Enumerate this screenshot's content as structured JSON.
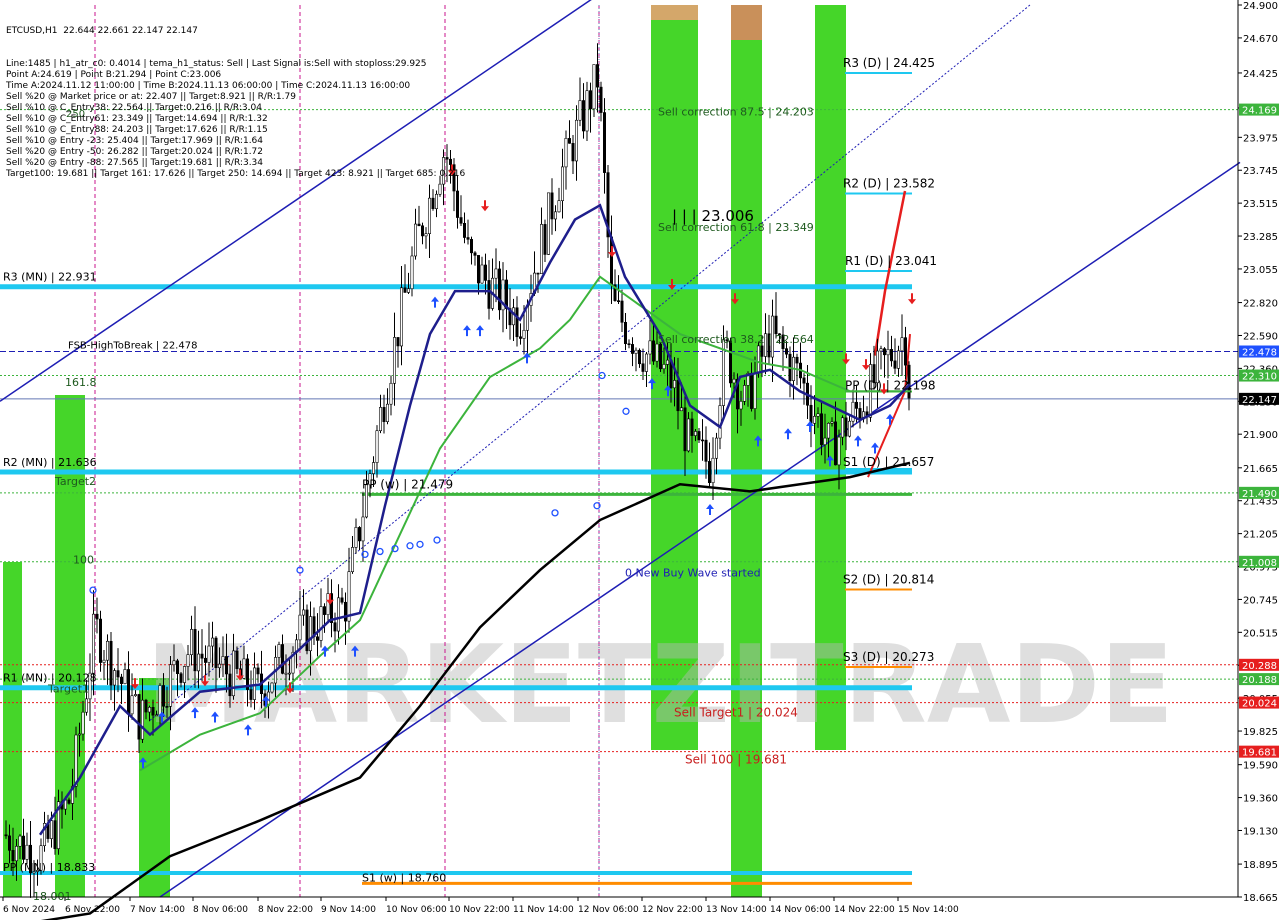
{
  "chart_data": {
    "type": "candlestick",
    "symbol_line": "ETCUSD,H1  22.644 22.661 22.147 22.147",
    "info_lines": [
      "Line:1485 | h1_atr_c0: 0.4014 | tema_h1_status: Sell | Last Signal is:Sell with stoploss:29.925",
      "Point A:24.619 | Point B:21.294 | Point C:23.006",
      "Time A:2024.11.12 11:00:00 | Time B:2024.11.13 06:00:00 | Time C:2024.11.13 16:00:00",
      "Sell %20 @ Market price or at: 22.407 || Target:8.921 || R/R:1.79",
      "Sell %10 @ C_Entry38: 22.564 || Target:0.216 || R/R:3.04",
      "Sell %10 @ C_Entry61: 23.349 || Target:14.694 || R/R:1.32",
      "Sell %10 @ C_Entry88: 24.203 || Target:17.626 || R/R:1.15",
      "Sell %10 @ Entry -23: 25.404 || Target:17.969 || R/R:1.64",
      "Sell %20 @ Entry -50: 26.282 || Target:20.024 || R/R:1.72",
      "Sell %20 @ Entry -88: 27.565 || Target:19.681 || R/R:3.34",
      "Target100: 19.681 || Target 161: 17.626 || Target 250: 14.694 || Target 423: 8.921 || Target 685: 0.216"
    ],
    "y_ticks": [
      "24.900",
      "24.670",
      "24.425",
      "24.180",
      "23.975",
      "23.745",
      "23.515",
      "23.285",
      "23.055",
      "22.820",
      "22.590",
      "22.360",
      "22.130",
      "21.900",
      "21.665",
      "21.435",
      "21.205",
      "20.975",
      "20.745",
      "20.515",
      "20.285",
      "20.055",
      "19.825",
      "19.590",
      "19.360",
      "19.130",
      "18.895",
      "18.665"
    ],
    "y_range": [
      18.665,
      24.9
    ],
    "x_labels": [
      "6 Nov 2024",
      "6 Nov 22:00",
      "7 Nov 14:00",
      "8 Nov 06:00",
      "8 Nov 22:00",
      "9 Nov 14:00",
      "10 Nov 06:00",
      "10 Nov 22:00",
      "11 Nov 14:00",
      "12 Nov 06:00",
      "12 Nov 22:00",
      "13 Nov 14:00",
      "14 Nov 06:00",
      "14 Nov 22:00",
      "15 Nov 14:00"
    ],
    "price_badges": [
      {
        "value": "24.169",
        "color": "#3cb43c"
      },
      {
        "value": "22.478",
        "color": "#1e50ff"
      },
      {
        "value": "22.310",
        "color": "#3cb43c"
      },
      {
        "value": "22.147",
        "color": "#000000"
      },
      {
        "value": "21.490",
        "color": "#3cb43c"
      },
      {
        "value": "21.008",
        "color": "#3cb43c"
      },
      {
        "value": "20.288",
        "color": "#e61e1e"
      },
      {
        "value": "20.188",
        "color": "#3cb43c"
      },
      {
        "value": "20.024",
        "color": "#e61e1e"
      },
      {
        "value": "19.681",
        "color": "#e61e1e"
      }
    ],
    "levels": [
      {
        "label": "R3 (MN) | 22.931",
        "value": 22.931,
        "color": "#1ec8f0"
      },
      {
        "label": "R2 (MN) | 21.636",
        "value": 21.636,
        "color": "#1ec8f0"
      },
      {
        "label": "R1 (MN) | 20.128",
        "value": 20.128,
        "color": "#1ec8f0"
      },
      {
        "label": "PP (MN) | 18.833",
        "value": 18.833,
        "color": "#1ec8f0"
      },
      {
        "label": "S1 (w) | 18.760",
        "value": 18.76,
        "color": "#ff8c00"
      },
      {
        "label": "FSB-HighToBreak | 22.478",
        "value": 22.478,
        "color": "#1e1eb4"
      },
      {
        "label": "R3 (D) | 24.425",
        "value": 24.425,
        "color": "#1ec8f0"
      },
      {
        "label": "R2 (D) | 23.582",
        "value": 23.582,
        "color": "#1ec8f0"
      },
      {
        "label": "R1 (D) | 23.041",
        "value": 23.041,
        "color": "#1ec8f0"
      },
      {
        "label": "PP (D) | 22.198",
        "value": 22.198,
        "color": "#3cb43c"
      },
      {
        "label": "S1 (D) | 21.657",
        "value": 21.657,
        "color": "#1ec8f0"
      },
      {
        "label": "S2 (D) | 20.814",
        "value": 20.814,
        "color": "#ff8c00"
      },
      {
        "label": "S3 (D) | 20.273",
        "value": 20.273,
        "color": "#ff8c00"
      },
      {
        "label": "PP (w) | 21.479",
        "value": 21.479,
        "color": "#3cb43c"
      }
    ],
    "annotations": [
      "Sell correction 87.5 | 24.203",
      "Sell correction 61.8 | 23.349",
      "Sell correction 38.2 | 22.564",
      "| | | 23.006",
      "0 New Buy Wave started",
      "Sell Target1 | 20.024",
      "Sell 100 | 19.681",
      "161.8",
      "Target2",
      "100",
      "Target1",
      "18.001",
      "250"
    ],
    "watermark": "MARKETZITRADE"
  }
}
